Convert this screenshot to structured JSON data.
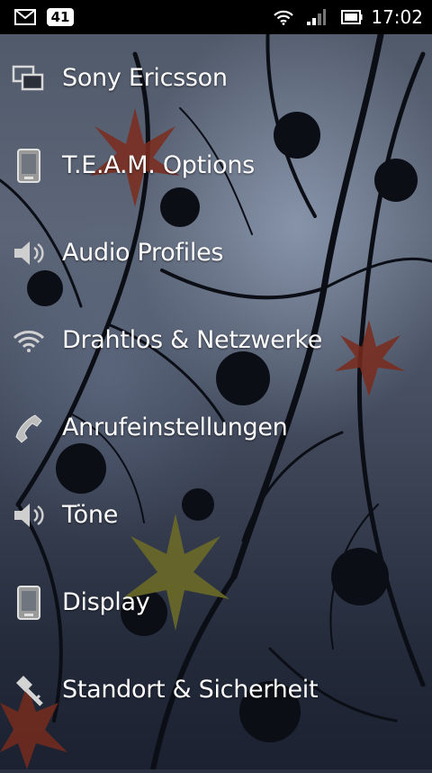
{
  "status_bar": {
    "gmail_icon": "gmail-icon",
    "notification_count": "41",
    "wifi_icon": "wifi-icon",
    "signal_icon": "signal-icon",
    "battery_icon": "battery-icon",
    "time": "17:02"
  },
  "menu": {
    "items": [
      {
        "label": "Sony Ericsson",
        "icon": "windows-icon"
      },
      {
        "label": "T.E.A.M. Options",
        "icon": "phone-device-icon"
      },
      {
        "label": "Audio Profiles",
        "icon": "speaker-icon"
      },
      {
        "label": "Drahtlos & Netzwerke",
        "icon": "wifi-icon"
      },
      {
        "label": "Anrufeinstellungen",
        "icon": "phone-handset-icon"
      },
      {
        "label": "Töne",
        "icon": "speaker-icon"
      },
      {
        "label": "Display",
        "icon": "phone-device-icon"
      },
      {
        "label": "Standort & Sicherheit",
        "icon": "key-location-icon"
      }
    ]
  },
  "colors": {
    "status_bar_bg": "#000000",
    "text": "#ffffff",
    "leaf_red": "#8a2e1e",
    "leaf_olive": "#6b6a28"
  }
}
